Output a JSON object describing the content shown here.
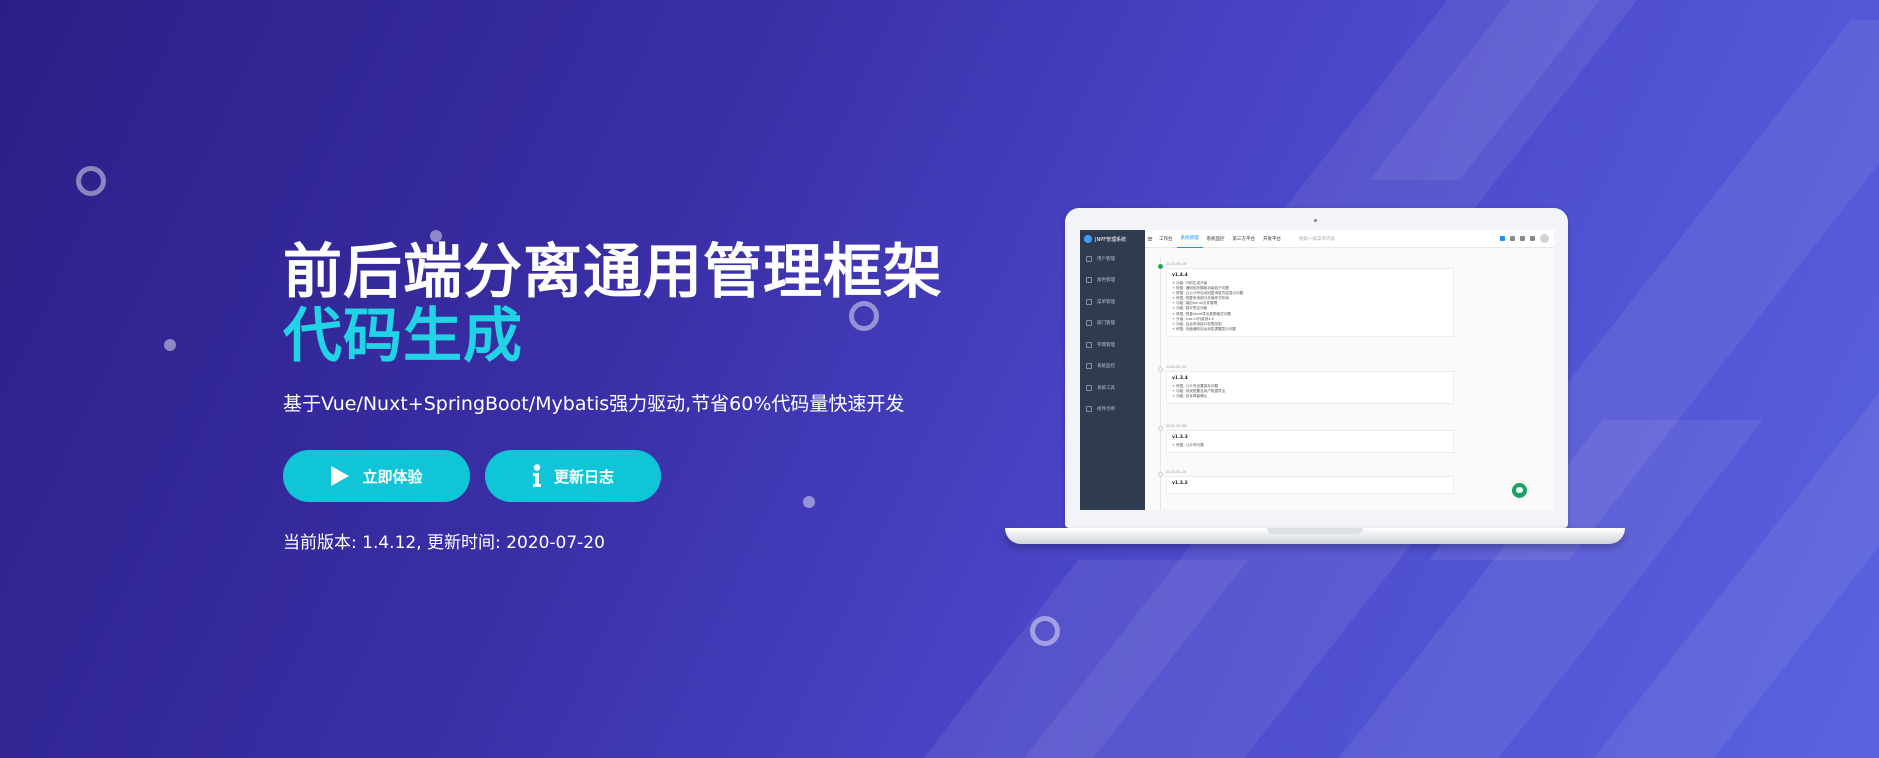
{
  "hero": {
    "title_line1": "前后端分离通用管理框架",
    "title_line2": "代码生成",
    "subtitle": "基于Vue/Nuxt+SpringBoot/Mybatis强力驱动,节省60%代码量快速开发",
    "buttons": {
      "try": {
        "label": "立即体验",
        "icon": "play-icon"
      },
      "changelog": {
        "label": "更新日志",
        "icon": "info-icon"
      }
    },
    "version_info": "当前版本: 1.4.12, 更新时间: 2020-07-20"
  },
  "colors": {
    "accent": "#22d3e6",
    "button": "#11c5d9",
    "bg_start": "#2b1f86",
    "bg_end": "#5a63df"
  },
  "screen": {
    "app_name": "JNPF管理系统",
    "sidebar": [
      "用户管理",
      "角色管理",
      "菜单管理",
      "部门管理",
      "字典管理",
      "系统监控",
      "系统工具",
      "组件示例"
    ],
    "topbar_tabs": [
      "工作台",
      "系统管理",
      "系统监控",
      "第三方平台",
      "开发平台"
    ],
    "search_placeholder": "搜索一级菜单内容",
    "entries": [
      {
        "date": "2020-06-18",
        "version": "v1.4.4",
        "lines": [
          "+ 功能: 代码生成升级",
          "+ 修复: 通知相关模板功能若干问题",
          "+ 修复: 云公众号自动回复消息内容显示问题",
          "+ 修复: 修复系统部分页面样式布局",
          "+ 功能: 增加minio文件管理",
          "+ 功能: 数字签名功能",
          "+ 修复: 修复excel导出数据格式问题",
          "+ 升级: vue-cli升级到4.0",
          "+ 功能: 后台系统接口权限控制",
          "+ 修复: 页面通知后台消息提醒显示问题"
        ]
      },
      {
        "date": "2020-05-25",
        "version": "v1.3.4",
        "lines": [
          "+ 修复: 公众号设置保存问题",
          "+ 功能: 系统配置及用户数据导出",
          "+ 功能: 优化弹窗确认"
        ]
      },
      {
        "date": "2020-05-06",
        "version": "v1.3.3",
        "lines": [
          "+ 修复: 公众号问题"
        ]
      },
      {
        "date": "2020-04-20",
        "version": "v1.3.2",
        "lines": []
      }
    ]
  }
}
